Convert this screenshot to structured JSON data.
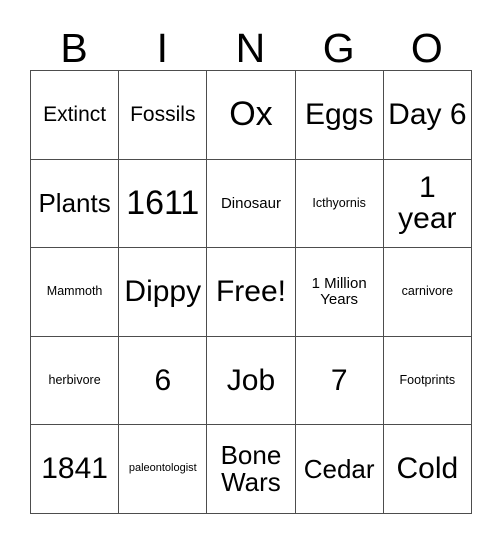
{
  "card": {
    "headers": [
      "B",
      "I",
      "N",
      "G",
      "O"
    ],
    "rows": [
      [
        {
          "text": "Extinct",
          "size": "fs-m"
        },
        {
          "text": "Fossils",
          "size": "fs-m"
        },
        {
          "text": "Ox",
          "size": "fs-xxl"
        },
        {
          "text": "Eggs",
          "size": "fs-xl"
        },
        {
          "text": "Day 6",
          "size": "fs-xl"
        }
      ],
      [
        {
          "text": "Plants",
          "size": "fs-l"
        },
        {
          "text": "1611",
          "size": "fs-xxl"
        },
        {
          "text": "Dinosaur",
          "size": "fs-s"
        },
        {
          "text": "Icthyornis",
          "size": "fs-xs"
        },
        {
          "text": "1 year",
          "size": "fs-xl"
        }
      ],
      [
        {
          "text": "Mammoth",
          "size": "fs-xs"
        },
        {
          "text": "Dippy",
          "size": "fs-xl"
        },
        {
          "text": "Free!",
          "size": "fs-xl"
        },
        {
          "text": "1 Million Years",
          "size": "fs-s"
        },
        {
          "text": "carnivore",
          "size": "fs-xs"
        }
      ],
      [
        {
          "text": "herbivore",
          "size": "fs-xs"
        },
        {
          "text": "6",
          "size": "fs-xl"
        },
        {
          "text": "Job",
          "size": "fs-xl"
        },
        {
          "text": "7",
          "size": "fs-xl"
        },
        {
          "text": "Footprints",
          "size": "fs-xs"
        }
      ],
      [
        {
          "text": "1841",
          "size": "fs-xl"
        },
        {
          "text": "paleontologist",
          "size": "fs-xxs"
        },
        {
          "text": "Bone Wars",
          "size": "fs-l"
        },
        {
          "text": "Cedar",
          "size": "fs-l"
        },
        {
          "text": "Cold",
          "size": "fs-xl"
        }
      ]
    ],
    "free_space_label": "Free!",
    "colors": {
      "background": "#ffffff",
      "text": "#000000",
      "grid_line": "#4d4d4d"
    }
  }
}
